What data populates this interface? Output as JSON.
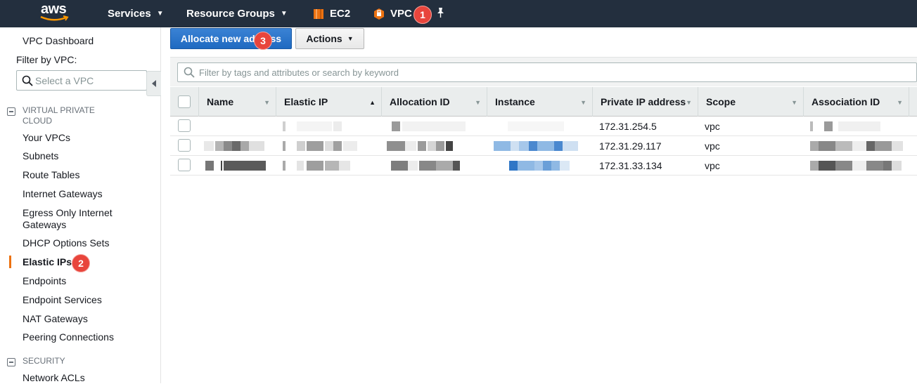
{
  "nav": {
    "logo_text": "aws",
    "services": "Services",
    "resource_groups": "Resource Groups",
    "ec2": "EC2",
    "vpc": "VPC",
    "callouts": [
      "1",
      "2",
      "3"
    ],
    "brand_color": "#232f3e",
    "service_icon_color": "#ec7211"
  },
  "sidebar": {
    "dashboard": "VPC Dashboard",
    "filter_label": "Filter by VPC:",
    "filter_placeholder": "Select a VPC",
    "section_vpc": "VIRTUAL PRIVATE CLOUD",
    "items": [
      "Your VPCs",
      "Subnets",
      "Route Tables",
      "Internet Gateways",
      "Egress Only Internet Gateways",
      "DHCP Options Sets",
      "Elastic IPs",
      "Endpoints",
      "Endpoint Services",
      "NAT Gateways",
      "Peering Connections"
    ],
    "active_item": "Elastic IPs",
    "section_security": "SECURITY",
    "security_items": [
      "Network ACLs"
    ]
  },
  "toolbar": {
    "allocate": "Allocate new address",
    "actions": "Actions"
  },
  "filter": {
    "placeholder": "Filter by tags and attributes or search by keyword"
  },
  "table": {
    "columns": [
      "Name",
      "Elastic IP",
      "Allocation ID",
      "Instance",
      "Private IP address",
      "Scope",
      "Association ID"
    ],
    "sorted_column": "Elastic IP",
    "rows": [
      {
        "name": "",
        "elastic_ip": "",
        "allocation_id": "",
        "instance": "",
        "private_ip": "172.31.254.5",
        "scope": "vpc",
        "association_id": ""
      },
      {
        "name": "",
        "elastic_ip": "",
        "allocation_id": "",
        "instance": "",
        "private_ip": "172.31.29.117",
        "scope": "vpc",
        "association_id": ""
      },
      {
        "name": "",
        "elastic_ip": "",
        "allocation_id": "",
        "instance": "",
        "private_ip": "172.31.33.134",
        "scope": "vpc",
        "association_id": ""
      }
    ]
  }
}
